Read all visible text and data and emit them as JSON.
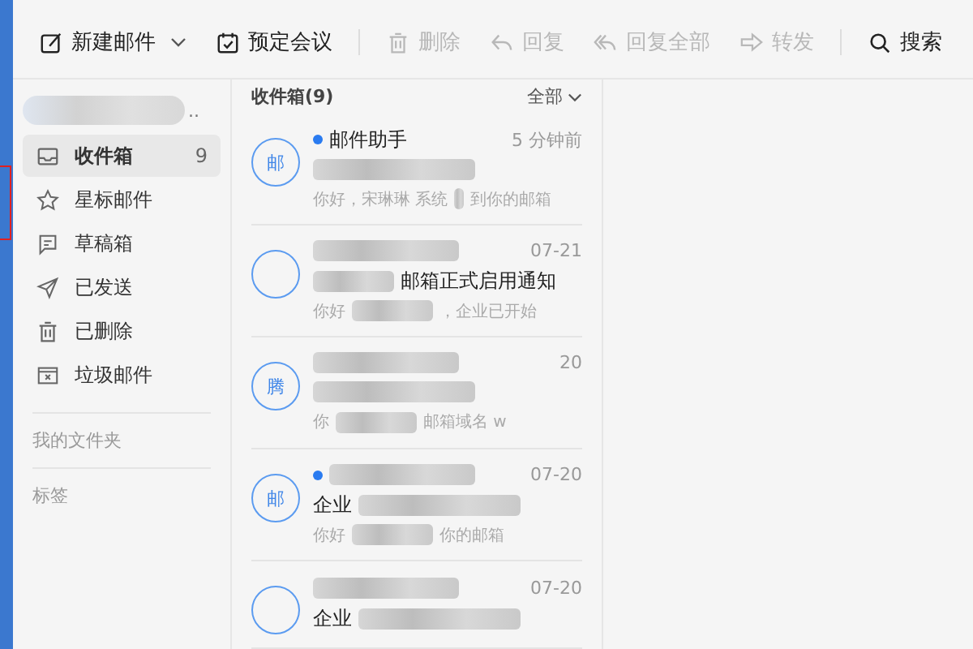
{
  "toolbar": {
    "groups": [
      [
        {
          "label": "新建邮件",
          "disabled": false,
          "menu": true
        },
        {
          "label": "预定会议",
          "disabled": false,
          "menu": false
        }
      ],
      [
        {
          "label": "删除",
          "disabled": true,
          "menu": false
        },
        {
          "label": "回复",
          "disabled": true,
          "menu": false
        },
        {
          "label": "回复全部",
          "disabled": true,
          "menu": false
        },
        {
          "label": "转发",
          "disabled": true,
          "menu": false
        }
      ],
      [
        {
          "label": "搜索",
          "disabled": false,
          "menu": false
        }
      ]
    ]
  },
  "sidebar": {
    "account": "..",
    "folders": [
      {
        "label": "收件箱",
        "count": "9",
        "selected": true
      },
      {
        "label": "星标邮件",
        "selected": false
      },
      {
        "label": "草稿箱",
        "selected": false
      },
      {
        "label": "已发送",
        "selected": false
      },
      {
        "label": "已删除",
        "selected": false
      },
      {
        "label": "垃圾邮件",
        "selected": false
      }
    ],
    "sections": [
      "我的文件夹",
      "标签"
    ]
  },
  "mail_list": {
    "title": "收件箱(9)",
    "filter": "全部",
    "messages": [
      {
        "avatar": "邮",
        "unread": true,
        "sender": "邮件助手",
        "time": "5 分钟前",
        "preview": "你好，宋琳琳 系统",
        "preview_end": "到你的邮箱"
      },
      {
        "unread": false,
        "time": "07-21",
        "subject_end": "邮箱正式启用通知",
        "preview": "你好",
        "preview_end": "，企业已开始"
      },
      {
        "avatar": "腾",
        "unread": false,
        "time": "20",
        "preview": "你",
        "preview_end": "邮箱域名 w"
      },
      {
        "avatar": "邮",
        "unread": true,
        "time": "07-20",
        "subject": "企业",
        "preview": "你好",
        "preview_end": "你的邮箱"
      },
      {
        "unread": false,
        "time": "07-20",
        "subject": "企业"
      }
    ]
  }
}
